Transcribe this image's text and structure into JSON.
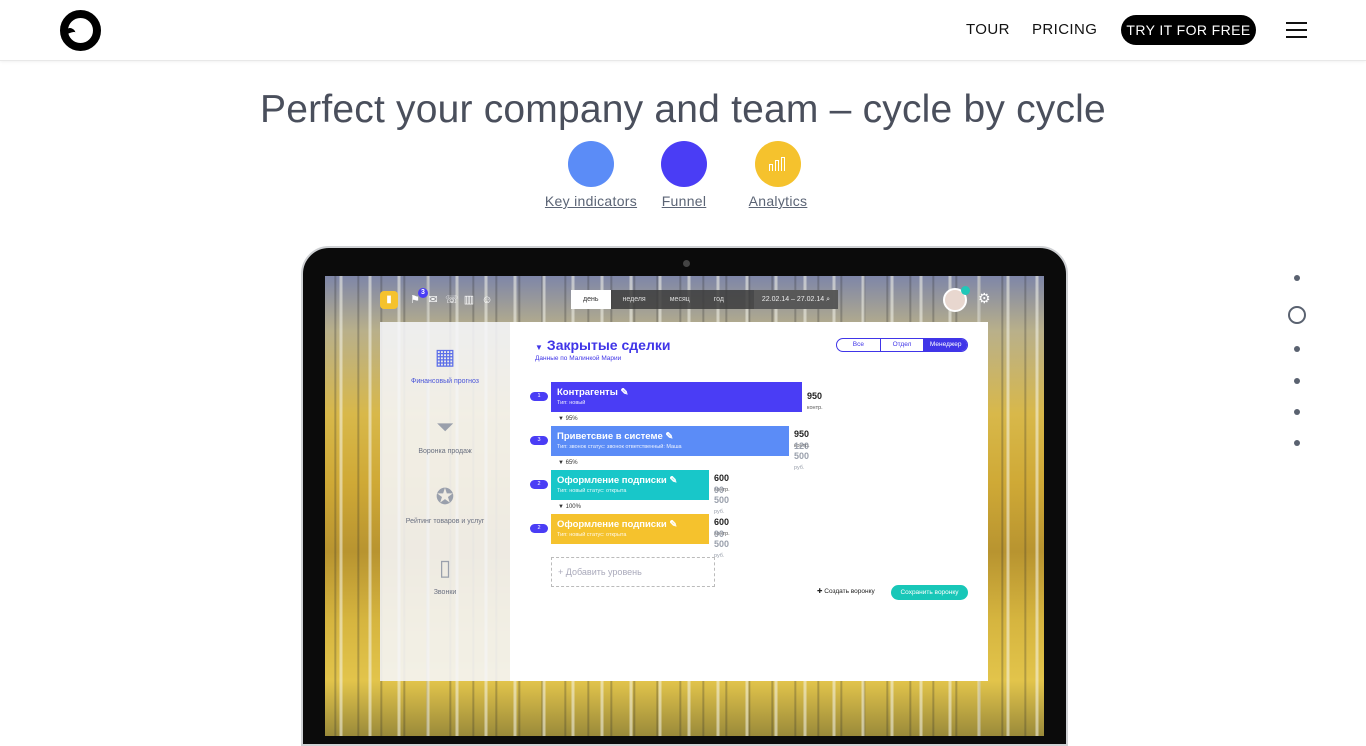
{
  "header": {
    "nav": {
      "tour": "TOUR",
      "pricing": "PRICING"
    },
    "cta": "TRY IT FOR FREE"
  },
  "hero": {
    "title": "Perfect your company and team – cycle by cycle",
    "features": [
      {
        "label": "Key indicators",
        "color": "#5b8cf7"
      },
      {
        "label": "Funnel",
        "color": "#4a3df5"
      },
      {
        "label": "Analytics",
        "color": "#f5c22d",
        "icon": "bar-chart-icon"
      }
    ]
  },
  "pager": {
    "count": 6,
    "active": 2
  },
  "app": {
    "toolbar": {
      "notifications_badge": "3",
      "period_tabs": [
        "день",
        "неделя",
        "месяц",
        "год"
      ],
      "active_period": "день",
      "range": "22.02.14 – 27.02.14"
    },
    "sidebar": [
      {
        "label": "Финансовый прогноз",
        "icon": "calculator-icon",
        "active": true
      },
      {
        "label": "Воронка продаж",
        "icon": "funnel-icon",
        "active": false
      },
      {
        "label": "Рейтинг товаров и услуг",
        "icon": "medal-icon",
        "active": false
      },
      {
        "label": "Звонки",
        "icon": "phone-vibrate-icon",
        "active": false
      }
    ],
    "main": {
      "title": "Закрытые сделки",
      "subtitle": "Данные по Малинкой Марии",
      "filter": [
        "Все",
        "Отдел",
        "Менеджер"
      ],
      "active_filter": "Менеджер",
      "levels": [
        {
          "pill": "1",
          "name": "Контрагенты",
          "sub": "Тип: новый",
          "value": "950",
          "unit": "контр.",
          "amount": "",
          "amount_unit": "",
          "color": "#4a3df5",
          "fill": 1.0
        },
        {
          "pill": "3",
          "name": "Приветсвие в системе",
          "sub": "Тип: звонок   статус: звонок   ответственный: Маша",
          "value": "950",
          "unit": "контр.",
          "amount": "120 500",
          "amount_unit": "руб.",
          "color": "#5b8cf7",
          "fill": 0.95
        },
        {
          "pill": "2",
          "name": "Оформление подписки",
          "sub": "Тип: новый   статус: открыта",
          "value": "600",
          "unit": "контр.",
          "amount": "90 500",
          "amount_unit": "руб.",
          "color": "#18c7c9",
          "fill": 0.63
        },
        {
          "pill": "2",
          "name": "Оформление подписки",
          "sub": "Тип: новый   статус: открыта",
          "value": "600",
          "unit": "контр.",
          "amount": "90 500",
          "amount_unit": "руб.",
          "color": "#f5c22d",
          "fill": 0.63
        }
      ],
      "conversions": [
        "95%",
        "65%",
        "100%"
      ],
      "add_level": "+ Добавить уровень",
      "create_funnel": "Создать воронку",
      "save_funnel": "Сохранить воронку"
    }
  }
}
